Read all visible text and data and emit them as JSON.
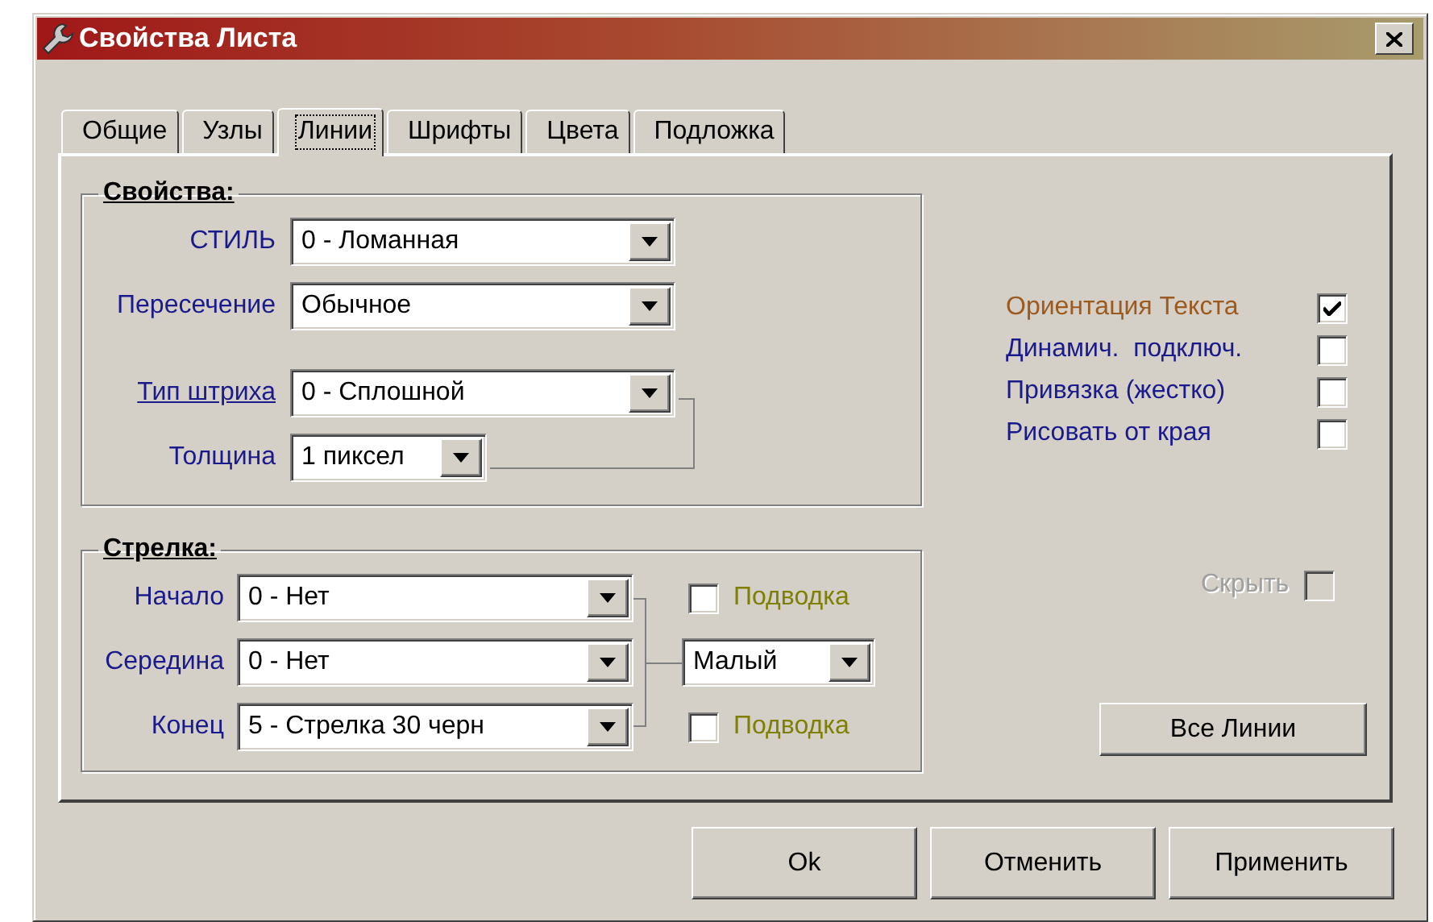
{
  "window": {
    "title": "Свойства Листа"
  },
  "tabs": [
    {
      "label": "Общие",
      "selected": false
    },
    {
      "label": "Узлы",
      "selected": false
    },
    {
      "label": "Линии",
      "selected": true
    },
    {
      "label": "Шрифты",
      "selected": false
    },
    {
      "label": "Цвета",
      "selected": false
    },
    {
      "label": "Подложка",
      "selected": false
    }
  ],
  "properties": {
    "title": "Свойства:",
    "fields": [
      {
        "label": "СТИЛЬ",
        "kind": "label",
        "value": "0 - Ломанная"
      },
      {
        "label": "Пересечение",
        "kind": "label",
        "value": "Обычное"
      },
      {
        "label": "Тип штриха",
        "kind": "link",
        "value": "0 - Сплошной"
      },
      {
        "label": "Толщина",
        "kind": "label",
        "value": "1 пиксел"
      }
    ]
  },
  "arrow": {
    "title": "Стрелка:",
    "fields": [
      {
        "label": "Начало",
        "value": "0 - Нет"
      },
      {
        "label": "Середина",
        "value": "0 - Нет"
      },
      {
        "label": "Конец",
        "value": "5 - Стрелка 30 черн"
      }
    ],
    "outline_top": {
      "label": "Подводка",
      "checked": false
    },
    "size": {
      "value": "Малый"
    },
    "outline_bottom": {
      "label": "Подводка",
      "checked": false
    }
  },
  "options": [
    {
      "label": "Ориентация Текста",
      "checked": true,
      "color": "#9c5a1e"
    },
    {
      "label": "Динамич.  подключ.",
      "checked": false,
      "color": "#1a1a8c"
    },
    {
      "label": "Привязка (жестко)",
      "checked": false,
      "color": "#1a1a8c"
    },
    {
      "label": "Рисовать от края",
      "checked": false,
      "color": "#1a1a8c"
    }
  ],
  "hide": {
    "label": "Скрыть",
    "checked": false,
    "disabled": true
  },
  "all_lines_button": "Все Линии",
  "buttons": [
    "Ok",
    "Отменить",
    "Применить"
  ]
}
